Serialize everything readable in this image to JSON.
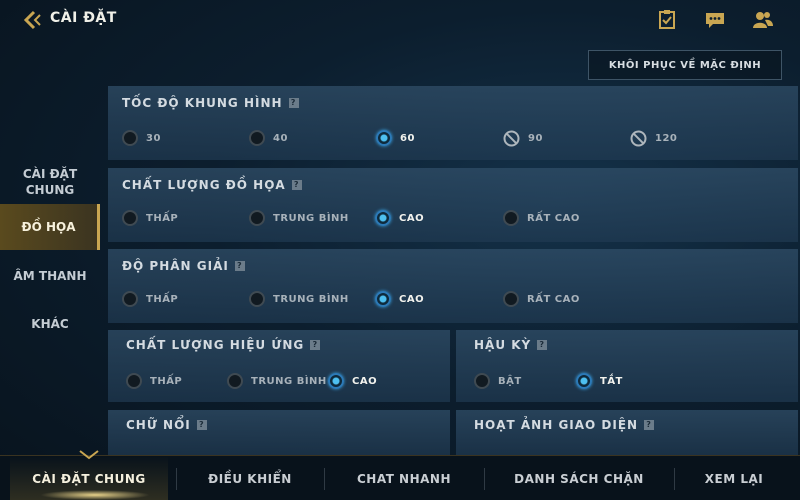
{
  "header": {
    "title": "CÀI ĐẶT",
    "icons": [
      "back-arrow-icon",
      "missions-icon",
      "chat-icon",
      "friends-icon"
    ]
  },
  "restore_button": "KHÔI PHỤC VỀ MẶC ĐỊNH",
  "sidebar": {
    "items": [
      {
        "label_line1": "CÀI ĐẶT",
        "label_line2": "CHUNG"
      },
      {
        "label": "ĐỒ HỌA",
        "active": true
      },
      {
        "label": "ÂM THANH"
      },
      {
        "label": "KHÁC"
      }
    ]
  },
  "help_glyph": "?",
  "sections": {
    "fps": {
      "title": "TỐC ĐỘ KHUNG HÌNH",
      "options": [
        {
          "label": "30",
          "state": "off"
        },
        {
          "label": "40",
          "state": "off"
        },
        {
          "label": "60",
          "state": "selected"
        },
        {
          "label": "90",
          "state": "disabled"
        },
        {
          "label": "120",
          "state": "disabled"
        }
      ]
    },
    "graphics_quality": {
      "title": "CHẤT LƯỢNG ĐỒ HỌA",
      "options": [
        {
          "label": "THẤP",
          "state": "off"
        },
        {
          "label": "TRUNG BÌNH",
          "state": "off"
        },
        {
          "label": "CAO",
          "state": "selected"
        },
        {
          "label": "RẤT CAO",
          "state": "off"
        }
      ]
    },
    "resolution": {
      "title": "ĐỘ PHÂN GIẢI",
      "options": [
        {
          "label": "THẤP",
          "state": "off"
        },
        {
          "label": "TRUNG BÌNH",
          "state": "off"
        },
        {
          "label": "CAO",
          "state": "selected"
        },
        {
          "label": "RẤT CAO",
          "state": "off"
        }
      ]
    },
    "effects_quality": {
      "title": "CHẤT LƯỢNG HIỆU ỨNG",
      "options": [
        {
          "label": "THẤP",
          "state": "off"
        },
        {
          "label": "TRUNG BÌNH",
          "state": "off"
        },
        {
          "label": "CAO",
          "state": "selected"
        }
      ]
    },
    "post_processing": {
      "title": "HẬU KỲ",
      "options": [
        {
          "label": "BẬT",
          "state": "off"
        },
        {
          "label": "TẮT",
          "state": "selected"
        }
      ]
    },
    "floating_text": {
      "title": "CHỮ NỔI"
    },
    "ui_animation": {
      "title": "HOẠT ẢNH GIAO DIỆN"
    }
  },
  "bottom_tabs": [
    {
      "label": "CÀI ĐẶT CHUNG",
      "active": true
    },
    {
      "label": "ĐIỀU KHIỂN"
    },
    {
      "label": "CHAT NHANH"
    },
    {
      "label": "DANH SÁCH CHẶN"
    },
    {
      "label": "XEM LẠI"
    }
  ],
  "colors": {
    "accent_gold": "#c9a652",
    "selected_blue": "#4ec0f0",
    "panel": "#304e68",
    "background": "#0c1e2e"
  }
}
